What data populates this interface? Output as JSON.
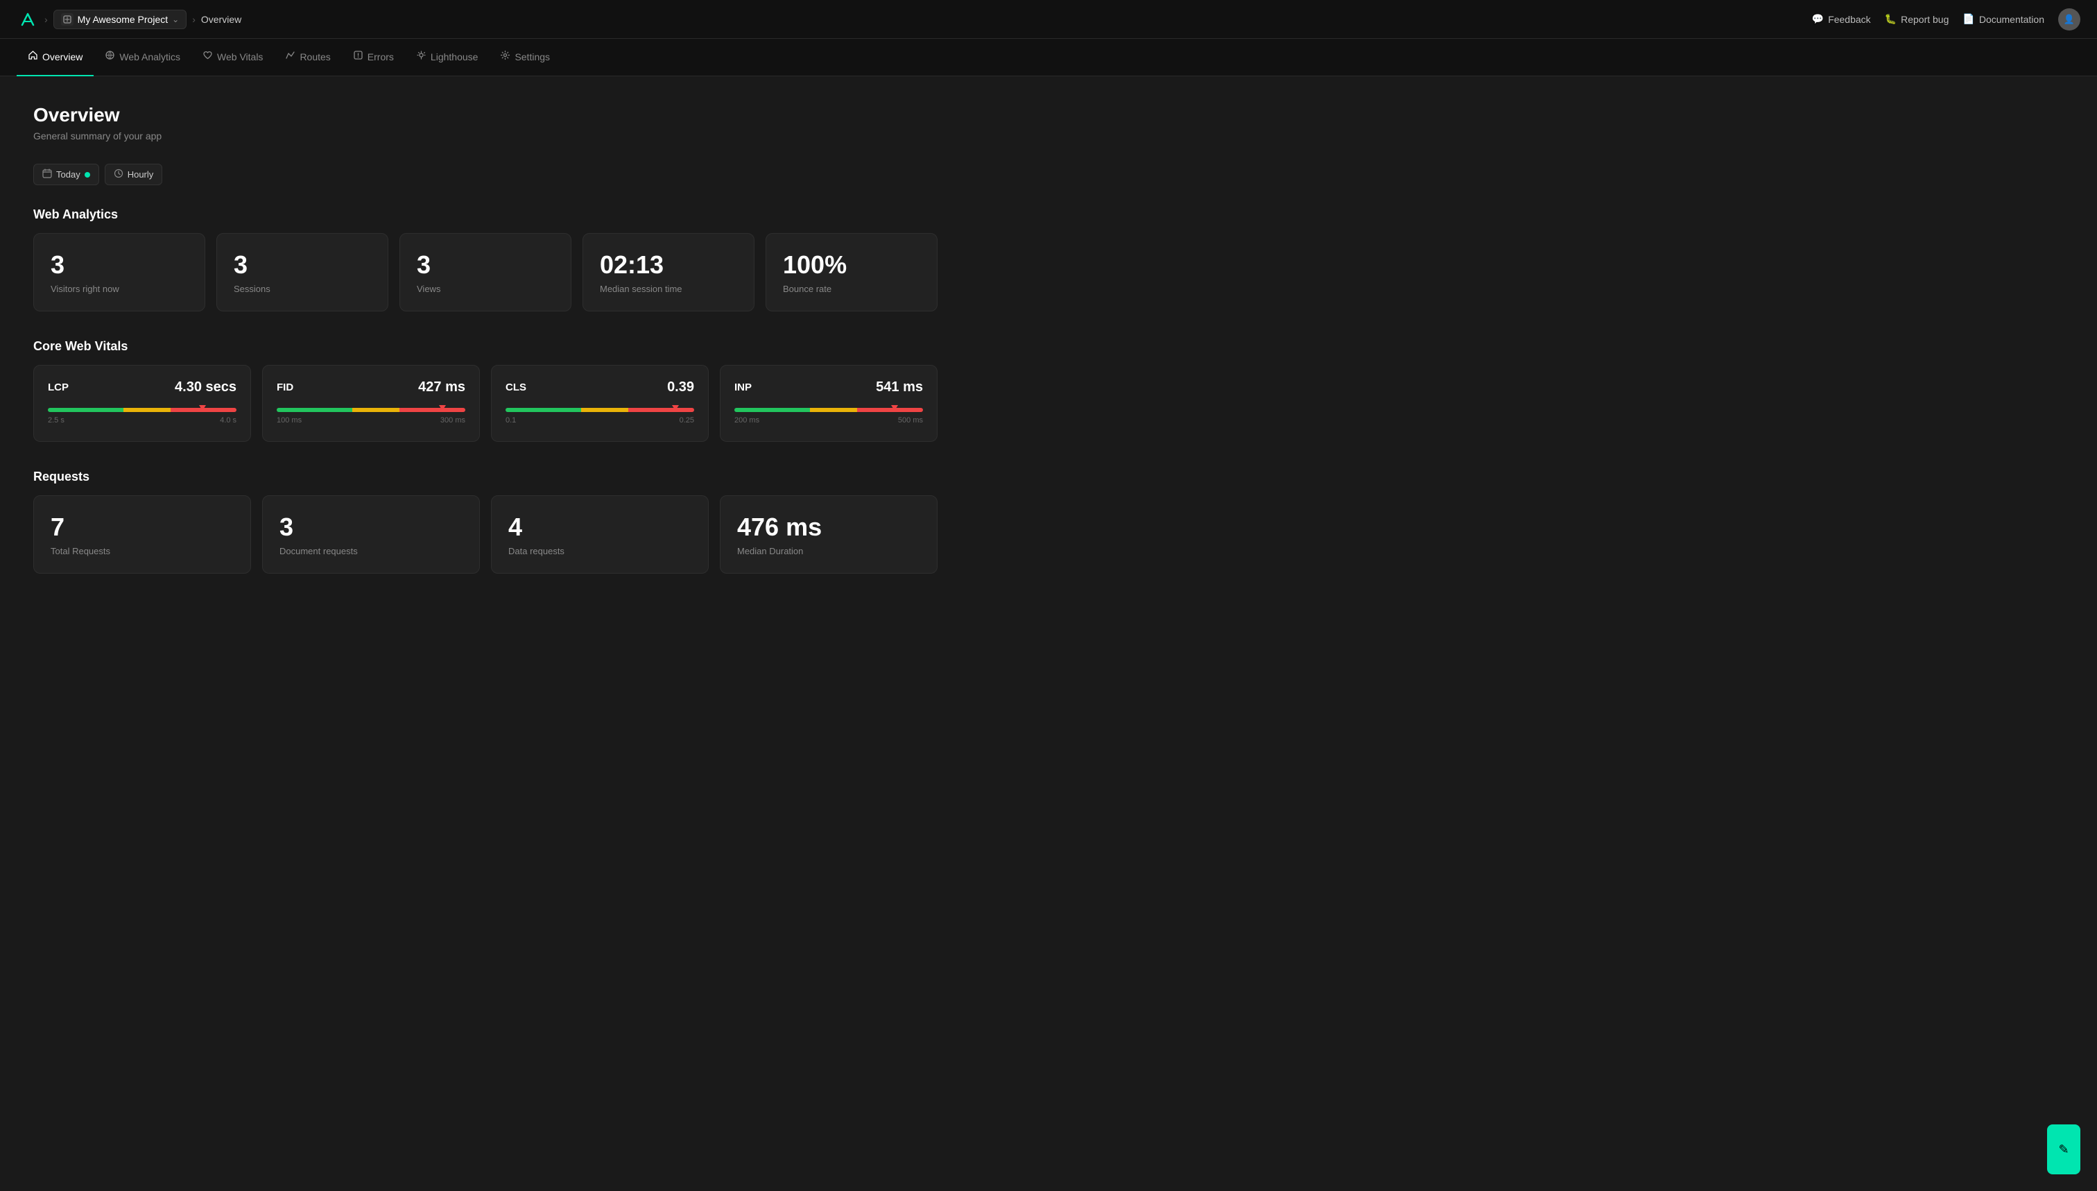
{
  "topNav": {
    "projectName": "My Awesome Project",
    "breadcrumbCurrent": "Overview",
    "actions": [
      {
        "label": "Feedback",
        "icon": "message-icon"
      },
      {
        "label": "Report bug",
        "icon": "bug-icon"
      },
      {
        "label": "Documentation",
        "icon": "doc-icon"
      }
    ]
  },
  "tabs": [
    {
      "label": "Overview",
      "icon": "🏠",
      "active": true
    },
    {
      "label": "Web Analytics",
      "icon": "🌐",
      "active": false
    },
    {
      "label": "Web Vitals",
      "icon": "❤️",
      "active": false
    },
    {
      "label": "Routes",
      "icon": "📈",
      "active": false
    },
    {
      "label": "Errors",
      "icon": "📦",
      "active": false
    },
    {
      "label": "Lighthouse",
      "icon": "🔦",
      "active": false
    },
    {
      "label": "Settings",
      "icon": "⚙️",
      "active": false
    }
  ],
  "page": {
    "title": "Overview",
    "subtitle": "General summary of your app"
  },
  "filters": {
    "dateLabel": "Today",
    "periodLabel": "Hourly"
  },
  "webAnalytics": {
    "sectionTitle": "Web Analytics",
    "metrics": [
      {
        "value": "3",
        "label": "Visitors right now"
      },
      {
        "value": "3",
        "label": "Sessions"
      },
      {
        "value": "3",
        "label": "Views"
      },
      {
        "value": "02:13",
        "label": "Median session time"
      },
      {
        "value": "100%",
        "label": "Bounce rate"
      }
    ]
  },
  "coreWebVitals": {
    "sectionTitle": "Core Web Vitals",
    "vitals": [
      {
        "name": "LCP",
        "score": "4.30 secs",
        "markerPct": 82,
        "labels": [
          "2.5 s",
          "4.0 s"
        ]
      },
      {
        "name": "FID",
        "score": "427 ms",
        "markerPct": 88,
        "labels": [
          "100 ms",
          "300 ms"
        ]
      },
      {
        "name": "CLS",
        "score": "0.39",
        "markerPct": 90,
        "labels": [
          "0.1",
          "0.25"
        ]
      },
      {
        "name": "INP",
        "score": "541 ms",
        "markerPct": 85,
        "labels": [
          "200 ms",
          "500 ms"
        ]
      }
    ]
  },
  "requests": {
    "sectionTitle": "Requests",
    "metrics": [
      {
        "value": "7",
        "label": "Total Requests"
      },
      {
        "value": "3",
        "label": "Document requests"
      },
      {
        "value": "4",
        "label": "Data requests"
      },
      {
        "value": "476 ms",
        "label": "Median Duration"
      }
    ]
  }
}
